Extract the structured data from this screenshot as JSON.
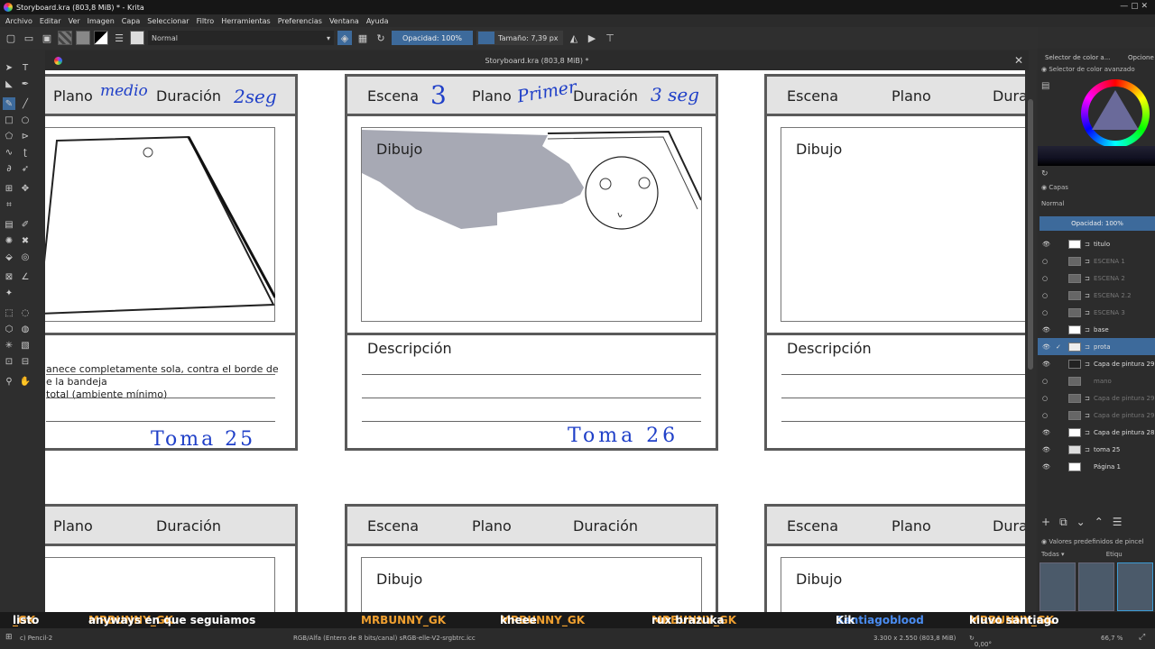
{
  "window": {
    "title": "Storyboard.kra (803,8 MiB) * - Krita"
  },
  "menu": [
    "Archivo",
    "Editar",
    "Ver",
    "Imagen",
    "Capa",
    "Seleccionar",
    "Filtro",
    "Herramientas",
    "Preferencias",
    "Ventana",
    "Ayuda"
  ],
  "toolbar": {
    "blend_mode": "Normal",
    "opacity": "Opacidad: 100%",
    "size": "Tamaño: 7,39 px"
  },
  "document": {
    "tab_title": "Storyboard.kra (803,8 MiB) *"
  },
  "cards": {
    "c1": {
      "plano": "Plano",
      "duracion": "Duración",
      "hw_plano": "medio",
      "hw_dur": "2seg",
      "desc1": "anece completamente sola, contra el borde de",
      "desc2": "e la bandeja",
      "desc3": "total (ambiente mínimo)",
      "toma": "Toma 25"
    },
    "c2": {
      "escena": "Escena",
      "plano": "Plano",
      "duracion": "Duración",
      "hw_escena": "3",
      "hw_plano": "Primer",
      "hw_dur": "3 seg",
      "dibujo": "Dibujo",
      "descripcion": "Descripción",
      "toma": "Toma 26"
    },
    "c3": {
      "escena": "Escena",
      "plano": "Plano",
      "duracion": "Dura",
      "dibujo": "Dibujo",
      "descripcion": "Descripción"
    },
    "c4": {
      "plano": "Plano",
      "duracion": "Duración"
    },
    "c5": {
      "escena": "Escena",
      "plano": "Plano",
      "duracion": "Duración",
      "dibujo": "Dibujo"
    },
    "c6": {
      "escena": "Escena",
      "plano": "Plano",
      "duracion": "Dura",
      "dibujo": "Dibujo"
    }
  },
  "right_panel": {
    "tab1": "Selector de color a...",
    "tab2": "Opcione",
    "color_title": "Selector de color avanzado",
    "layers_title": "Capas",
    "layers_blend": "Normal",
    "layers_opacity": "Opacidad:  100%",
    "layers": [
      {
        "name": "titulo",
        "visible": true
      },
      {
        "name": "ESCENA 1",
        "visible": false
      },
      {
        "name": "ESCENA 2",
        "visible": false
      },
      {
        "name": "ESCENA 2.2",
        "visible": false
      },
      {
        "name": "ESCENA 3",
        "visible": false
      },
      {
        "name": "base",
        "visible": true
      },
      {
        "name": "prota",
        "visible": true,
        "selected": true
      },
      {
        "name": "Capa de pintura 29",
        "visible": true
      },
      {
        "name": "mano",
        "visible": false
      },
      {
        "name": "Capa de pintura 29",
        "visible": false
      },
      {
        "name": "Capa de pintura 29",
        "visible": false
      },
      {
        "name": "Capa de pintura 28",
        "visible": true
      },
      {
        "name": "toma 25",
        "visible": true
      },
      {
        "name": "Página 1",
        "visible": true
      }
    ],
    "presets_title": "Valores predefinidos de pincel",
    "presets_filter": "Todas",
    "presets_tag": "Etiqu"
  },
  "chat": [
    {
      "nick": "_GK",
      "msg": "listo"
    },
    {
      "nick": "MRBUNNY_GK",
      "msg": "anyways en que seguiamos"
    },
    {
      "nick": "MRBUNNY_GK",
      "msg": ""
    },
    {
      "nick": "MRBUNNY_GK",
      "msg": "kheee"
    },
    {
      "nick": "MRBUNNY_GK",
      "msg": "rux brazuka"
    },
    {
      "nick": "Santiagoblood",
      "msg": "Kik"
    },
    {
      "nick": "MRBUNNY_GK",
      "msg": "kiuvo santiago"
    }
  ],
  "status": {
    "brush": "c) Pencil-2",
    "color": "RGB/Alfa (Entero de 8 bits/canal)  sRGB-elle-V2-srgbtrc.icc",
    "dims": "3.300 x 2.550 (803,8 MiB)",
    "angle": "0,00°",
    "zoom": "66,7 %"
  }
}
